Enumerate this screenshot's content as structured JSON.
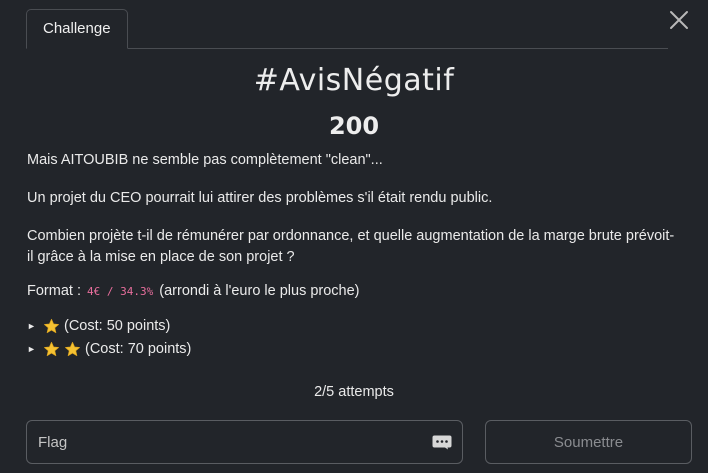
{
  "tabs": [
    {
      "label": "Challenge",
      "active": true
    }
  ],
  "challenge": {
    "name": "#AvisNégatif",
    "value": "200",
    "description": {
      "p1": "Mais AITOUBIB ne semble pas complètement \"clean\"...",
      "p2": "Un projet du CEO pourrait lui attirer des problèmes s'il était rendu public.",
      "p3": "Combien projète t-il de rémunérer par ordonnance, et quelle augmentation de la marge brute prévoit-il grâce à la mise en place de son projet ?",
      "format_label": "Format :",
      "format_code": "4€ / 34.3%",
      "format_suffix": "(arrondi à l'euro le plus proche)"
    },
    "hints": [
      {
        "stars": 1,
        "cost_label": "(Cost: 50 points)"
      },
      {
        "stars": 2,
        "cost_label": "(Cost: 70 points)"
      }
    ],
    "attempts": "2/5 attempts"
  },
  "form": {
    "flag_placeholder": "Flag",
    "flag_value": "",
    "submit_label": "Soumettre"
  },
  "icons": {
    "close": "close-icon",
    "star": "star-icon",
    "caret": "triangle-right-icon",
    "input_addon": "chat-dots-icon"
  },
  "colors": {
    "background": "#22252a",
    "code_text": "#e76e9c",
    "star": "#f5c232"
  }
}
